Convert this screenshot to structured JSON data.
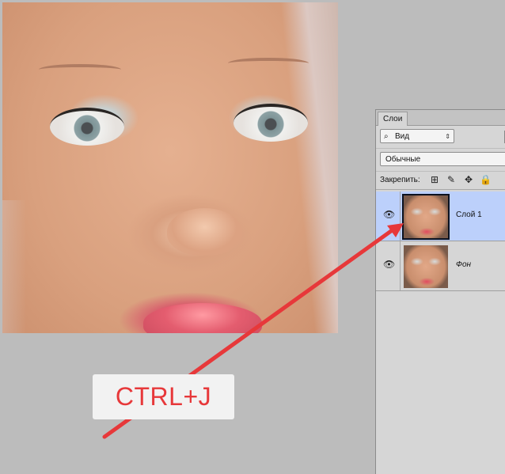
{
  "canvas": {
    "image": "portrait-photo"
  },
  "layers_panel": {
    "tab_label": "Слои",
    "filter_select": {
      "icon": "search-icon",
      "value": "Вид"
    },
    "blend_mode_select": {
      "value": "Обычные"
    },
    "lock_label": "Закрепить:",
    "lock_icons": [
      "lock-transparent-pixels-icon",
      "lock-image-pixels-icon",
      "lock-position-icon",
      "lock-all-icon"
    ],
    "layers": [
      {
        "name": "Слой 1",
        "selected": true,
        "visible": true
      },
      {
        "name": "Фон",
        "selected": false,
        "visible": true
      }
    ]
  },
  "annotation": {
    "shortcut_text": "CTRL+J",
    "arrow_color": "#e7383a"
  }
}
